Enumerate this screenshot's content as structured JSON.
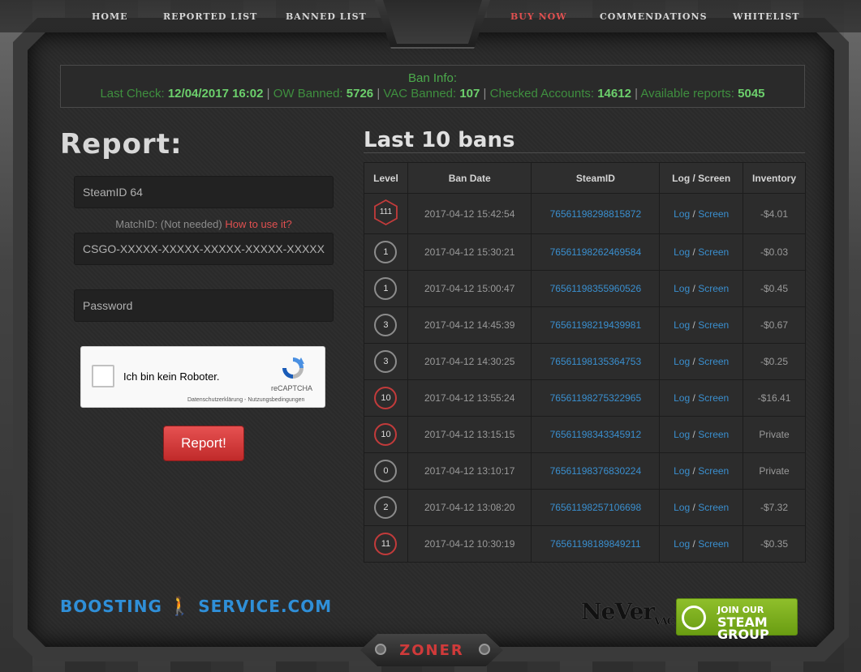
{
  "nav": {
    "items": [
      {
        "label": "HOME"
      },
      {
        "label": "REPORTED LIST"
      },
      {
        "label": "BANNED LIST"
      },
      {
        "label": "BUY NOW"
      },
      {
        "label": "COMMENDATIONS"
      },
      {
        "label": "WHITELIST"
      }
    ],
    "active": "BUY NOW"
  },
  "ban_info": {
    "title": "Ban Info:",
    "last_check_label": "Last Check:",
    "last_check_value": "12/04/2017 16:02",
    "ow_label": "OW Banned:",
    "ow_value": "5726",
    "vac_label": "VAC Banned:",
    "vac_value": "107",
    "checked_label": "Checked Accounts:",
    "checked_value": "14612",
    "reports_label": "Available reports:",
    "reports_value": "5045",
    "separator": "|"
  },
  "report": {
    "title": "Report:",
    "steamid_placeholder": "SteamID 64",
    "matchid_label": "MatchID: (Not needed)",
    "matchid_help": "How to use it?",
    "matchid_placeholder": "CSGO-XXXXX-XXXXX-XXXXX-XXXXX-XXXXX",
    "password_placeholder": "Password",
    "captcha_label": "Ich bin kein Roboter.",
    "captcha_brand": "reCAPTCHA",
    "captcha_terms": "Datenschutzerklärung - Nutzungsbedingungen",
    "submit_label": "Report!"
  },
  "bans": {
    "title": "Last 10 bans",
    "columns": [
      "Level",
      "Ban Date",
      "SteamID",
      "Log / Screen",
      "Inventory"
    ],
    "log_label": "Log",
    "screen_label": "Screen",
    "rows": [
      {
        "level": "111",
        "date": "2017-04-12 15:42:54",
        "steamid": "76561198298815872",
        "inventory": "-$4.01"
      },
      {
        "level": "1",
        "date": "2017-04-12 15:30:21",
        "steamid": "76561198262469584",
        "inventory": "-$0.03"
      },
      {
        "level": "1",
        "date": "2017-04-12 15:00:47",
        "steamid": "76561198355960526",
        "inventory": "-$0.45"
      },
      {
        "level": "3",
        "date": "2017-04-12 14:45:39",
        "steamid": "76561198219439981",
        "inventory": "-$0.67"
      },
      {
        "level": "3",
        "date": "2017-04-12 14:30:25",
        "steamid": "76561198135364753",
        "inventory": "-$0.25"
      },
      {
        "level": "10",
        "date": "2017-04-12 13:55:24",
        "steamid": "76561198275322965",
        "inventory": "-$16.41"
      },
      {
        "level": "10",
        "date": "2017-04-12 13:15:15",
        "steamid": "76561198343345912",
        "inventory": "Private"
      },
      {
        "level": "0",
        "date": "2017-04-12 13:10:17",
        "steamid": "76561198376830224",
        "inventory": "Private"
      },
      {
        "level": "2",
        "date": "2017-04-12 13:08:20",
        "steamid": "76561198257106698",
        "inventory": "-$7.32"
      },
      {
        "level": "11",
        "date": "2017-04-12 10:30:19",
        "steamid": "76561198189849211",
        "inventory": "-$0.35"
      }
    ]
  },
  "footer": {
    "boost_logo_a": "BOOSTING",
    "boost_logo_b": "SERVICE.COM",
    "never_logo": "NeVer",
    "never_logo_sub": "VAC",
    "steam_line1": "JOIN OUR",
    "steam_line2": "STEAM GROUP",
    "zoner": "ZONER"
  },
  "colors": {
    "accent_red": "#e05050",
    "link_blue": "#3a8fcf",
    "ban_green": "#6cd06c"
  }
}
